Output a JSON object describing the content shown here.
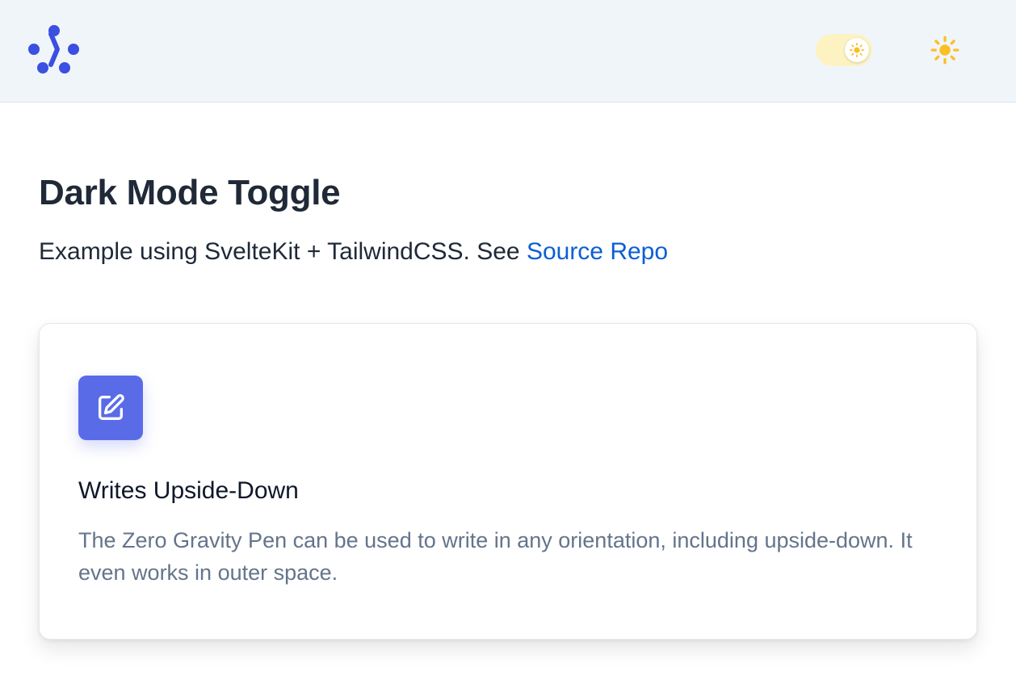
{
  "header": {
    "logo_icon": "dots-chevron-logo-icon",
    "theme_toggle": {
      "state": "light",
      "icon": "sun-icon",
      "track_color": "#fdf3c2"
    },
    "theme_button_icon": "sun-icon"
  },
  "main": {
    "title": "Dark Mode Toggle",
    "subtitle_text": "Example using SvelteKit + TailwindCSS. See ",
    "subtitle_link": "Source Repo"
  },
  "card": {
    "icon": "pencil-square-icon",
    "icon_bg": "#5a6be8",
    "title": "Writes Upside-Down",
    "description": "The Zero Gravity Pen can be used to write in any orientation, including upside-down. It even works in outer space."
  },
  "colors": {
    "brand": "#3b4fe0",
    "link": "#0b5fd1",
    "sun": "#fbbf24",
    "header_bg": "#f0f5fa"
  }
}
